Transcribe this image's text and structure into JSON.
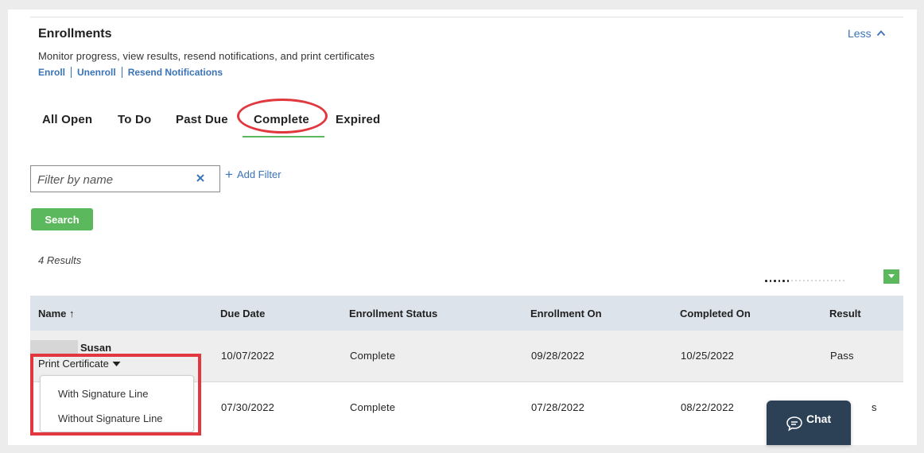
{
  "header": {
    "title": "Enrollments",
    "less_label": "Less",
    "subtitle": "Monitor progress, view results, resend notifications, and print certificates",
    "links": [
      "Enroll",
      "Unenroll",
      "Resend Notifications"
    ]
  },
  "tabs": [
    {
      "label": "All Open"
    },
    {
      "label": "To Do"
    },
    {
      "label": "Past Due"
    },
    {
      "label": "Complete",
      "active": true
    },
    {
      "label": "Expired"
    }
  ],
  "filter": {
    "placeholder": "Filter by name",
    "add_filter_label": "Add Filter",
    "search_label": "Search"
  },
  "results_label": "4 Results",
  "table": {
    "headers": [
      "Name ↑",
      "Due Date",
      "Enrollment Status",
      "Enrollment On",
      "Completed On",
      "Result"
    ],
    "rows": [
      {
        "name": "Susan",
        "due_date": "10/07/2022",
        "status": "Complete",
        "enrollment_on": "09/28/2022",
        "completed_on": "10/25/2022",
        "result": "Pass"
      },
      {
        "name": "",
        "due_date": "07/30/2022",
        "status": "Complete",
        "enrollment_on": "07/28/2022",
        "completed_on": "08/22/2022",
        "result": "s"
      }
    ]
  },
  "print_menu": {
    "label": "Print Certificate",
    "options": [
      "With Signature Line",
      "Without Signature Line"
    ]
  },
  "chat": {
    "label": "Chat"
  },
  "colors": {
    "accent_green": "#5cb85c",
    "link_blue": "#3a73b8",
    "highlight_red": "#e0383e",
    "chat_navy": "#2c4156"
  }
}
